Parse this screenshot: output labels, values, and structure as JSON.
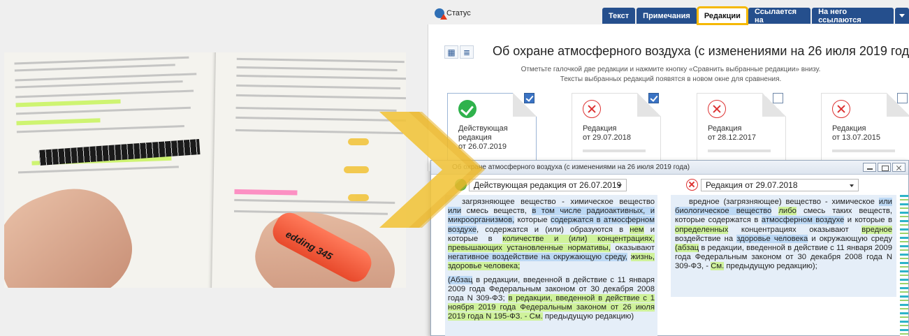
{
  "app": {
    "status_label": "Статус",
    "tabs": [
      "Текст",
      "Примечания",
      "Редакции",
      "Ссылается на",
      "На него ссылаются"
    ],
    "active_tab": "Редакции",
    "accent_color": "#f5b800",
    "tab_color": "#254f8d"
  },
  "document": {
    "title": "Об охране атмосферного воздуха (с изменениями на 26 июля 2019 года)",
    "hint_line1": "Отметьте галочкой две редакции и нажмите кнопку «Сравнить выбранные редакции» внизу.",
    "hint_line2": "Тексты выбранных редакций появятся в новом окне для сравнения."
  },
  "editions": [
    {
      "line1": "Действующая",
      "line2": "редакция",
      "line3": "от 26.07.2019",
      "status": "current",
      "checked": true
    },
    {
      "line1": "Редакция",
      "line2": "от 29.07.2018",
      "line3": "",
      "status": "old",
      "checked": true
    },
    {
      "line1": "Редакция",
      "line2": "от 28.12.2017",
      "line3": "",
      "status": "old",
      "checked": false
    },
    {
      "line1": "Редакция",
      "line2": "от 13.07.2015",
      "line3": "",
      "status": "old",
      "checked": false
    }
  ],
  "compare": {
    "window_title": "Об охране атмосферного воздуха (с изменениями на 26 июля 2019 года)",
    "left_select": "Действующая редакция от 26.07.2019",
    "right_select": "Редакция от 29.07.2018",
    "left_paragraph_1": [
      {
        "t": "загрязняющее вещество - химическое вещество ",
        "h": ""
      },
      {
        "t": "или",
        "h": "b"
      },
      {
        "t": " смесь веществ, ",
        "h": ""
      },
      {
        "t": "в том числе радиоактивных, и микроорганизмов,",
        "h": "b"
      },
      {
        "t": " которые ",
        "h": ""
      },
      {
        "t": "содержатся в атмосферном воздухе",
        "h": "b"
      },
      {
        "t": ", содержатся и (или) образуются в ",
        "h": ""
      },
      {
        "t": "нем",
        "h": "g"
      },
      {
        "t": " и которые в ",
        "h": ""
      },
      {
        "t": "количестве и (или) концентрациях, превышающих установленные нормативы,",
        "h": "g"
      },
      {
        "t": " оказывают ",
        "h": ""
      },
      {
        "t": "негативное воздействие на окружающую среду,",
        "h": "b"
      },
      {
        "t": " ",
        "h": ""
      },
      {
        "t": "жизнь, здоровье человека;",
        "h": "g"
      }
    ],
    "left_paragraph_2": [
      {
        "t": "(Абзац",
        "h": "b"
      },
      {
        "t": " в редакции, введенной в действие с 11 января 2009 года Федеральным законом от 30 декабря 2008 года N 309-ФЗ; ",
        "h": ""
      },
      {
        "t": "в редакции, введенной в действие с 1 ноября 2019 года Федеральным законом от 26 июля 2019 года N 195-ФЗ. - См.",
        "h": "g"
      },
      {
        "t": " предыдущую редакцию)",
        "h": ""
      }
    ],
    "right_paragraph_1": [
      {
        "t": "вредное (загрязняющее) вещество - химическое ",
        "h": ""
      },
      {
        "t": "или биологическое вещество",
        "h": "b"
      },
      {
        "t": " ",
        "h": ""
      },
      {
        "t": "либо",
        "h": "g"
      },
      {
        "t": " смесь таких веществ, которые содержатся в ",
        "h": ""
      },
      {
        "t": "атмосферном воздухе",
        "h": "b"
      },
      {
        "t": " и которые в ",
        "h": ""
      },
      {
        "t": "определенных",
        "h": "g"
      },
      {
        "t": " концентрациях оказывают ",
        "h": ""
      },
      {
        "t": "вредное",
        "h": "g"
      },
      {
        "t": " воздействие на ",
        "h": ""
      },
      {
        "t": "здоровье человека",
        "h": "b"
      },
      {
        "t": " и окружающую среду ",
        "h": ""
      },
      {
        "t": "(абзац",
        "h": "g"
      },
      {
        "t": " в редакции, введенной в действие с 11 января 2009 года Федеральным законом от 30 декабря 2008 года N 309-ФЗ, - ",
        "h": ""
      },
      {
        "t": "См.",
        "h": "g"
      },
      {
        "t": " предыдущую редакцию);",
        "h": ""
      }
    ]
  },
  "photo": {
    "marker_label": "edding 345",
    "marker_color": "#e84a2c",
    "highlight_green": "#c7f35a",
    "highlight_pink": "#ff6fb4"
  },
  "arrow_color": "#f2c43a"
}
